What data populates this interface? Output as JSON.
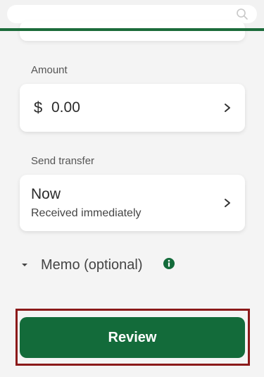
{
  "search": {
    "placeholder": ""
  },
  "amount": {
    "label": "Amount",
    "currency_symbol": "$",
    "value": "0.00"
  },
  "send_transfer": {
    "label": "Send transfer",
    "timing": "Now",
    "subtitle": "Received immediately"
  },
  "memo": {
    "label": "Memo (optional)"
  },
  "review": {
    "button_label": "Review"
  },
  "colors": {
    "brand_green": "#136b3a",
    "header_rule_green": "#1b6b3a",
    "focus_outline": "#8b1a1a",
    "page_bg": "#f4f4f4",
    "card_bg": "#ffffff"
  },
  "icons": {
    "search": "search-icon",
    "chevron": "chevron-right-icon",
    "caret": "caret-down-icon",
    "info": "info-icon"
  }
}
